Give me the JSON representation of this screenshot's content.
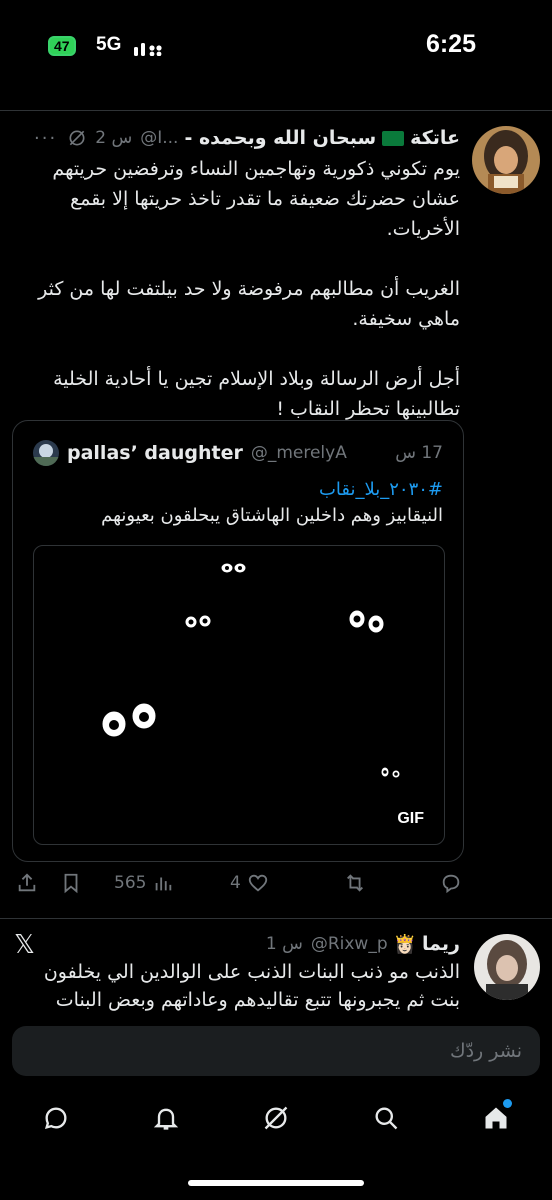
{
  "status_bar": {
    "battery": "47",
    "network": "5G",
    "time": "6:25",
    "icons": [
      "battery-charging-icon",
      "signal-bars-icon"
    ]
  },
  "tweet": {
    "author_name": "عاتكة",
    "author_suffix": "- سبحان الله وبحمده",
    "handle": "@I...",
    "time": "2 س",
    "more": "···",
    "text": "يوم تكوني ذكورية وتهاجمين النساء وترفضين حريتهم عشان حضرتك ضعيفة ما تقدر تاخذ حريتها إلا بقمع الأخريات.\n\nالغريب أن مطالبهم مرفوضة ولا حد بيلتفت لها من كثر ماهي سخيفة.\n\nأجل أرض الرسالة وبلاد الإسلام تجين يا أحادية الخلية تطالبينها تحظر النقاب !",
    "quote": {
      "name": "pallas’ daughter",
      "handle": "@_merelyA",
      "time": "17 س",
      "hashtag": "#٢٠٣٠_بلا_نقاب",
      "text": "النيقابيز وهم داخلين الهاشتاق يبحلقون بعيونهم",
      "media_label": "GIF"
    },
    "actions": {
      "views": "565",
      "likes": "4"
    }
  },
  "tweet2": {
    "author_name": "ريما",
    "handle": "@Rixw_p",
    "time": "1 س",
    "text_line1": "الذنب مو ذنب البنات الذنب على الوالدين الي يخلفون",
    "text_line2": "بنت ثم يجبرونها تتبع تقاليدهم وعاداتهم وبعض البنات"
  },
  "reply": {
    "placeholder": "نشر ردّك"
  },
  "nav": {
    "items": [
      "messages-icon",
      "notifications-icon",
      "grok-icon",
      "search-icon",
      "home-icon"
    ]
  },
  "colors": {
    "background": "#000000",
    "text": "#e7e9ea",
    "muted": "#71767b",
    "accent": "#1d9bf0",
    "divider": "#2f3336"
  }
}
